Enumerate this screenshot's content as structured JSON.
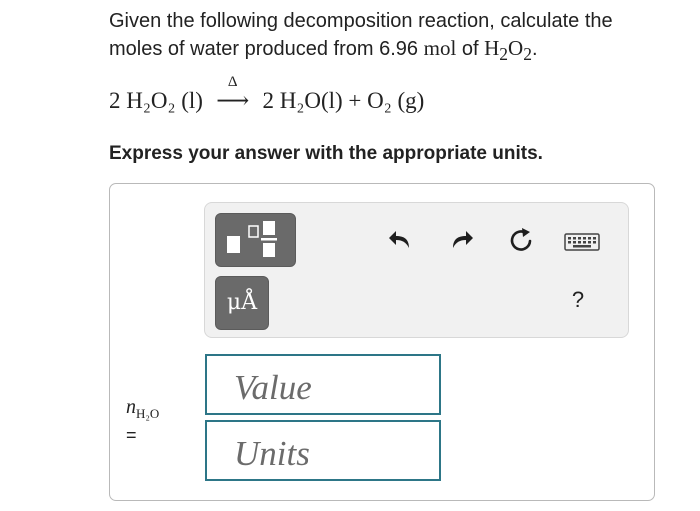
{
  "question": {
    "line1": "Given the following decomposition reaction, calculate the",
    "line2_pre": "moles of water produced from 6.96",
    "unit_mol": "mol",
    "line2_of": "of",
    "formula_main": "H",
    "formula_sub1": "2",
    "formula_o": "O",
    "formula_sub2": "2",
    "period": "."
  },
  "equation": {
    "reactant": "2 H₂O₂ (l)",
    "arrow": "⟶",
    "delta": "Δ",
    "products": "2 H₂O(l) + O₂ (g)"
  },
  "instruction": "Express your answer with the appropriate units.",
  "toolbar": {
    "units_label": "μÅ",
    "help_label": "?"
  },
  "answer": {
    "variable": "n",
    "variable_sub": "H₂O",
    "equals": "=",
    "value_placeholder": "Value",
    "units_placeholder": "Units"
  },
  "colors": {
    "field_border": "#2d7687",
    "button_bg": "#6a6a6a",
    "toolbar_bg": "#f1f1f1"
  }
}
